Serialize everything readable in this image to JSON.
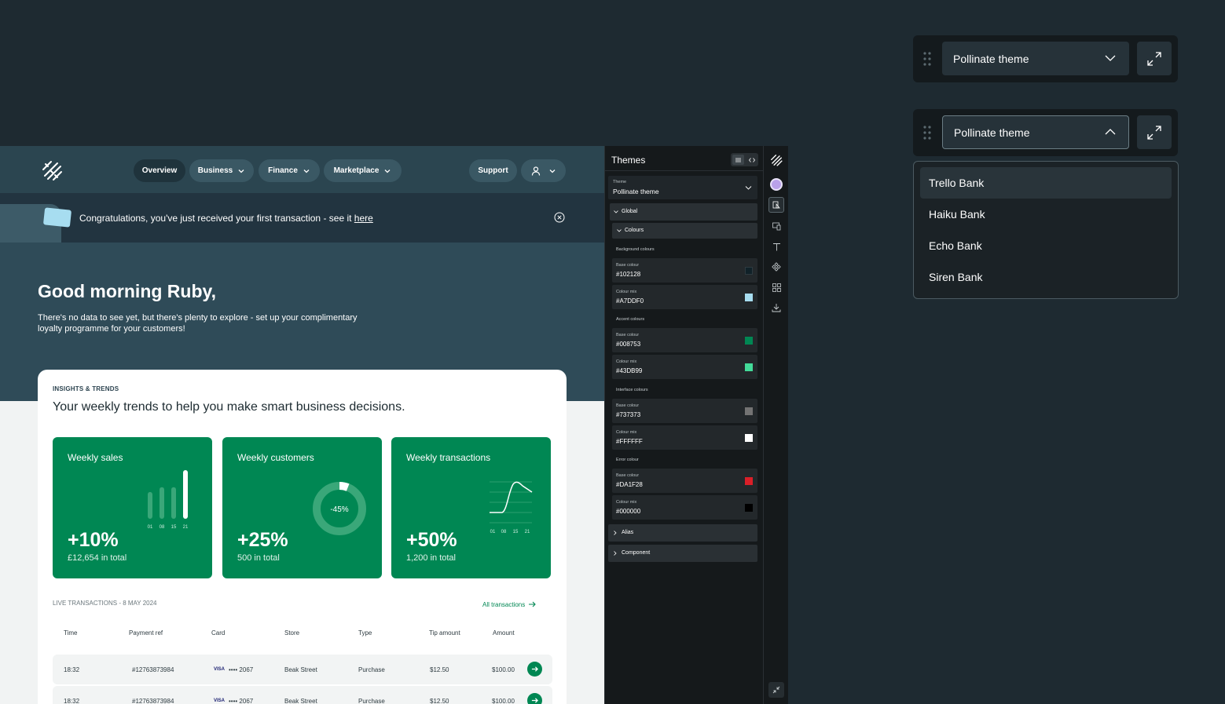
{
  "nav": {
    "overview": "Overview",
    "business": "Business",
    "finance": "Finance",
    "marketplace": "Marketplace",
    "support": "Support"
  },
  "banner": {
    "text": "Congratulations, you've just received your first transaction - see it",
    "link": "here"
  },
  "greeting": {
    "title": "Good morning Ruby,",
    "subtitle": "There's no data to see yet, but there's plenty to explore - set up your complimentary loyalty programme for your customers!"
  },
  "insights": {
    "kicker": "INSIGHTS & TRENDS",
    "heading": "Your weekly trends to help you make smart business decisions.",
    "tiles": [
      {
        "title": "Weekly sales",
        "value": "+10%",
        "sub": "£12,654 in total",
        "ticks": [
          "01",
          "08",
          "15",
          "21"
        ],
        "bars": [
          0.55,
          0.65,
          0.65,
          1.0
        ]
      },
      {
        "title": "Weekly customers",
        "value": "+25%",
        "sub": "500 in total",
        "donut_label": "-45%",
        "donut_fraction": 0.06
      },
      {
        "title": "Weekly transactions",
        "value": "+50%",
        "sub": "1,200 in total",
        "ticks": [
          "01",
          "08",
          "15",
          "21"
        ]
      }
    ]
  },
  "transactions": {
    "kicker": "LIVE TRANSACTIONS - 8 MAY 2024",
    "all_link": "All transactions",
    "headers": [
      "Time",
      "Payment ref",
      "Card",
      "Store",
      "Type",
      "Tip amount",
      "Amount"
    ],
    "rows": [
      {
        "time": "18:32",
        "ref": "#12763873984",
        "card_brand": "VISA",
        "card": "•••• 2067",
        "store": "Beak Street",
        "type": "Purchase",
        "tip": "$12.50",
        "amount": "$100.00"
      },
      {
        "time": "18:32",
        "ref": "#12763873984",
        "card_brand": "VISA",
        "card": "•••• 2067",
        "store": "Beak Street",
        "type": "Purchase",
        "tip": "$12.50",
        "amount": "$100.00"
      }
    ]
  },
  "themes_panel": {
    "title": "Themes",
    "theme_label": "Theme",
    "theme_value": "Pollinate theme",
    "global": "Global",
    "colours": "Colours",
    "sections": [
      {
        "name": "Background colours",
        "items": [
          {
            "label": "Base colour",
            "value": "#102128",
            "color": "#102128"
          },
          {
            "label": "Colour mix",
            "value": "#A7DDF0",
            "color": "#A7DDF0"
          }
        ]
      },
      {
        "name": "Accent colours",
        "items": [
          {
            "label": "Base colour",
            "value": "#008753",
            "color": "#008753"
          },
          {
            "label": "Colour mix",
            "value": "#43DB99",
            "color": "#43DB99"
          }
        ]
      },
      {
        "name": "Interface colours",
        "items": [
          {
            "label": "Base colour",
            "value": "#737373",
            "color": "#737373"
          },
          {
            "label": "Colour mix",
            "value": "#FFFFFF",
            "color": "#FFFFFF"
          }
        ]
      },
      {
        "name": "Error colour",
        "items": [
          {
            "label": "Base colour",
            "value": "#DA1F28",
            "color": "#DA1F28"
          },
          {
            "label": "Colour mix",
            "value": "#000000",
            "color": "#000000"
          }
        ]
      }
    ],
    "alias": "Alias",
    "component": "Component"
  },
  "theme_selector": {
    "closed_value": "Pollinate theme",
    "open_value": "Pollinate theme",
    "options": [
      "Trello Bank",
      "Haiku Bank",
      "Echo Bank",
      "Siren Bank"
    ]
  },
  "colors": {
    "accent": "#008753",
    "accent_mix": "#43DB99",
    "background": "#102128"
  }
}
